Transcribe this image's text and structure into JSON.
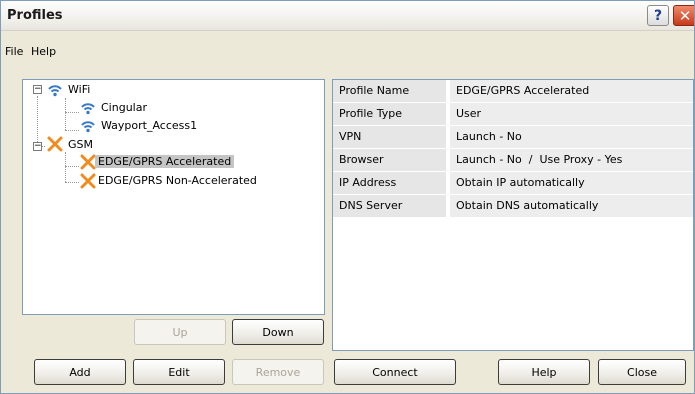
{
  "window": {
    "title": "Profiles"
  },
  "titlebar_buttons": {
    "help_glyph": "?",
    "close_glyph": "✕"
  },
  "menu": {
    "items": [
      "File",
      "Help"
    ]
  },
  "tree": {
    "groups": [
      {
        "label": "WiFi",
        "icon": "wifi-icon",
        "expanded": true,
        "children": [
          {
            "label": "Cingular",
            "icon": "wifi-icon",
            "selected": false
          },
          {
            "label": "Wayport_Access1",
            "icon": "wifi-icon",
            "selected": false
          }
        ]
      },
      {
        "label": "GSM",
        "icon": "gsm-icon",
        "expanded": true,
        "children": [
          {
            "label": "EDGE/GPRS Accelerated",
            "icon": "gsm-icon",
            "selected": true
          },
          {
            "label": "EDGE/GPRS Non-Accelerated",
            "icon": "gsm-icon",
            "selected": false
          }
        ]
      }
    ],
    "expander_glyph": "−"
  },
  "properties": [
    {
      "key": "Profile Name",
      "value": "EDGE/GPRS Accelerated"
    },
    {
      "key": "Profile Type",
      "value": "User"
    },
    {
      "key": "VPN",
      "value": "Launch - No"
    },
    {
      "key": "Browser",
      "value": "Launch - No  /  Use Proxy - Yes"
    },
    {
      "key": "IP Address",
      "value": "Obtain IP automatically"
    },
    {
      "key": "DNS Server",
      "value": "Obtain DNS automatically"
    }
  ],
  "buttons": {
    "up": {
      "label": "Up",
      "enabled": false
    },
    "down": {
      "label": "Down",
      "enabled": true
    },
    "add": {
      "label": "Add",
      "enabled": true
    },
    "edit": {
      "label": "Edit",
      "enabled": true
    },
    "remove": {
      "label": "Remove",
      "enabled": false
    },
    "connect": {
      "label": "Connect",
      "enabled": true
    },
    "help": {
      "label": "Help",
      "enabled": true
    },
    "close": {
      "label": "Close",
      "enabled": true
    }
  },
  "colors": {
    "wifi_icon": "#3a78c8",
    "gsm_icon": "#f08c1e",
    "selection": "#c5c5c5",
    "close_button": "#c9391a"
  }
}
